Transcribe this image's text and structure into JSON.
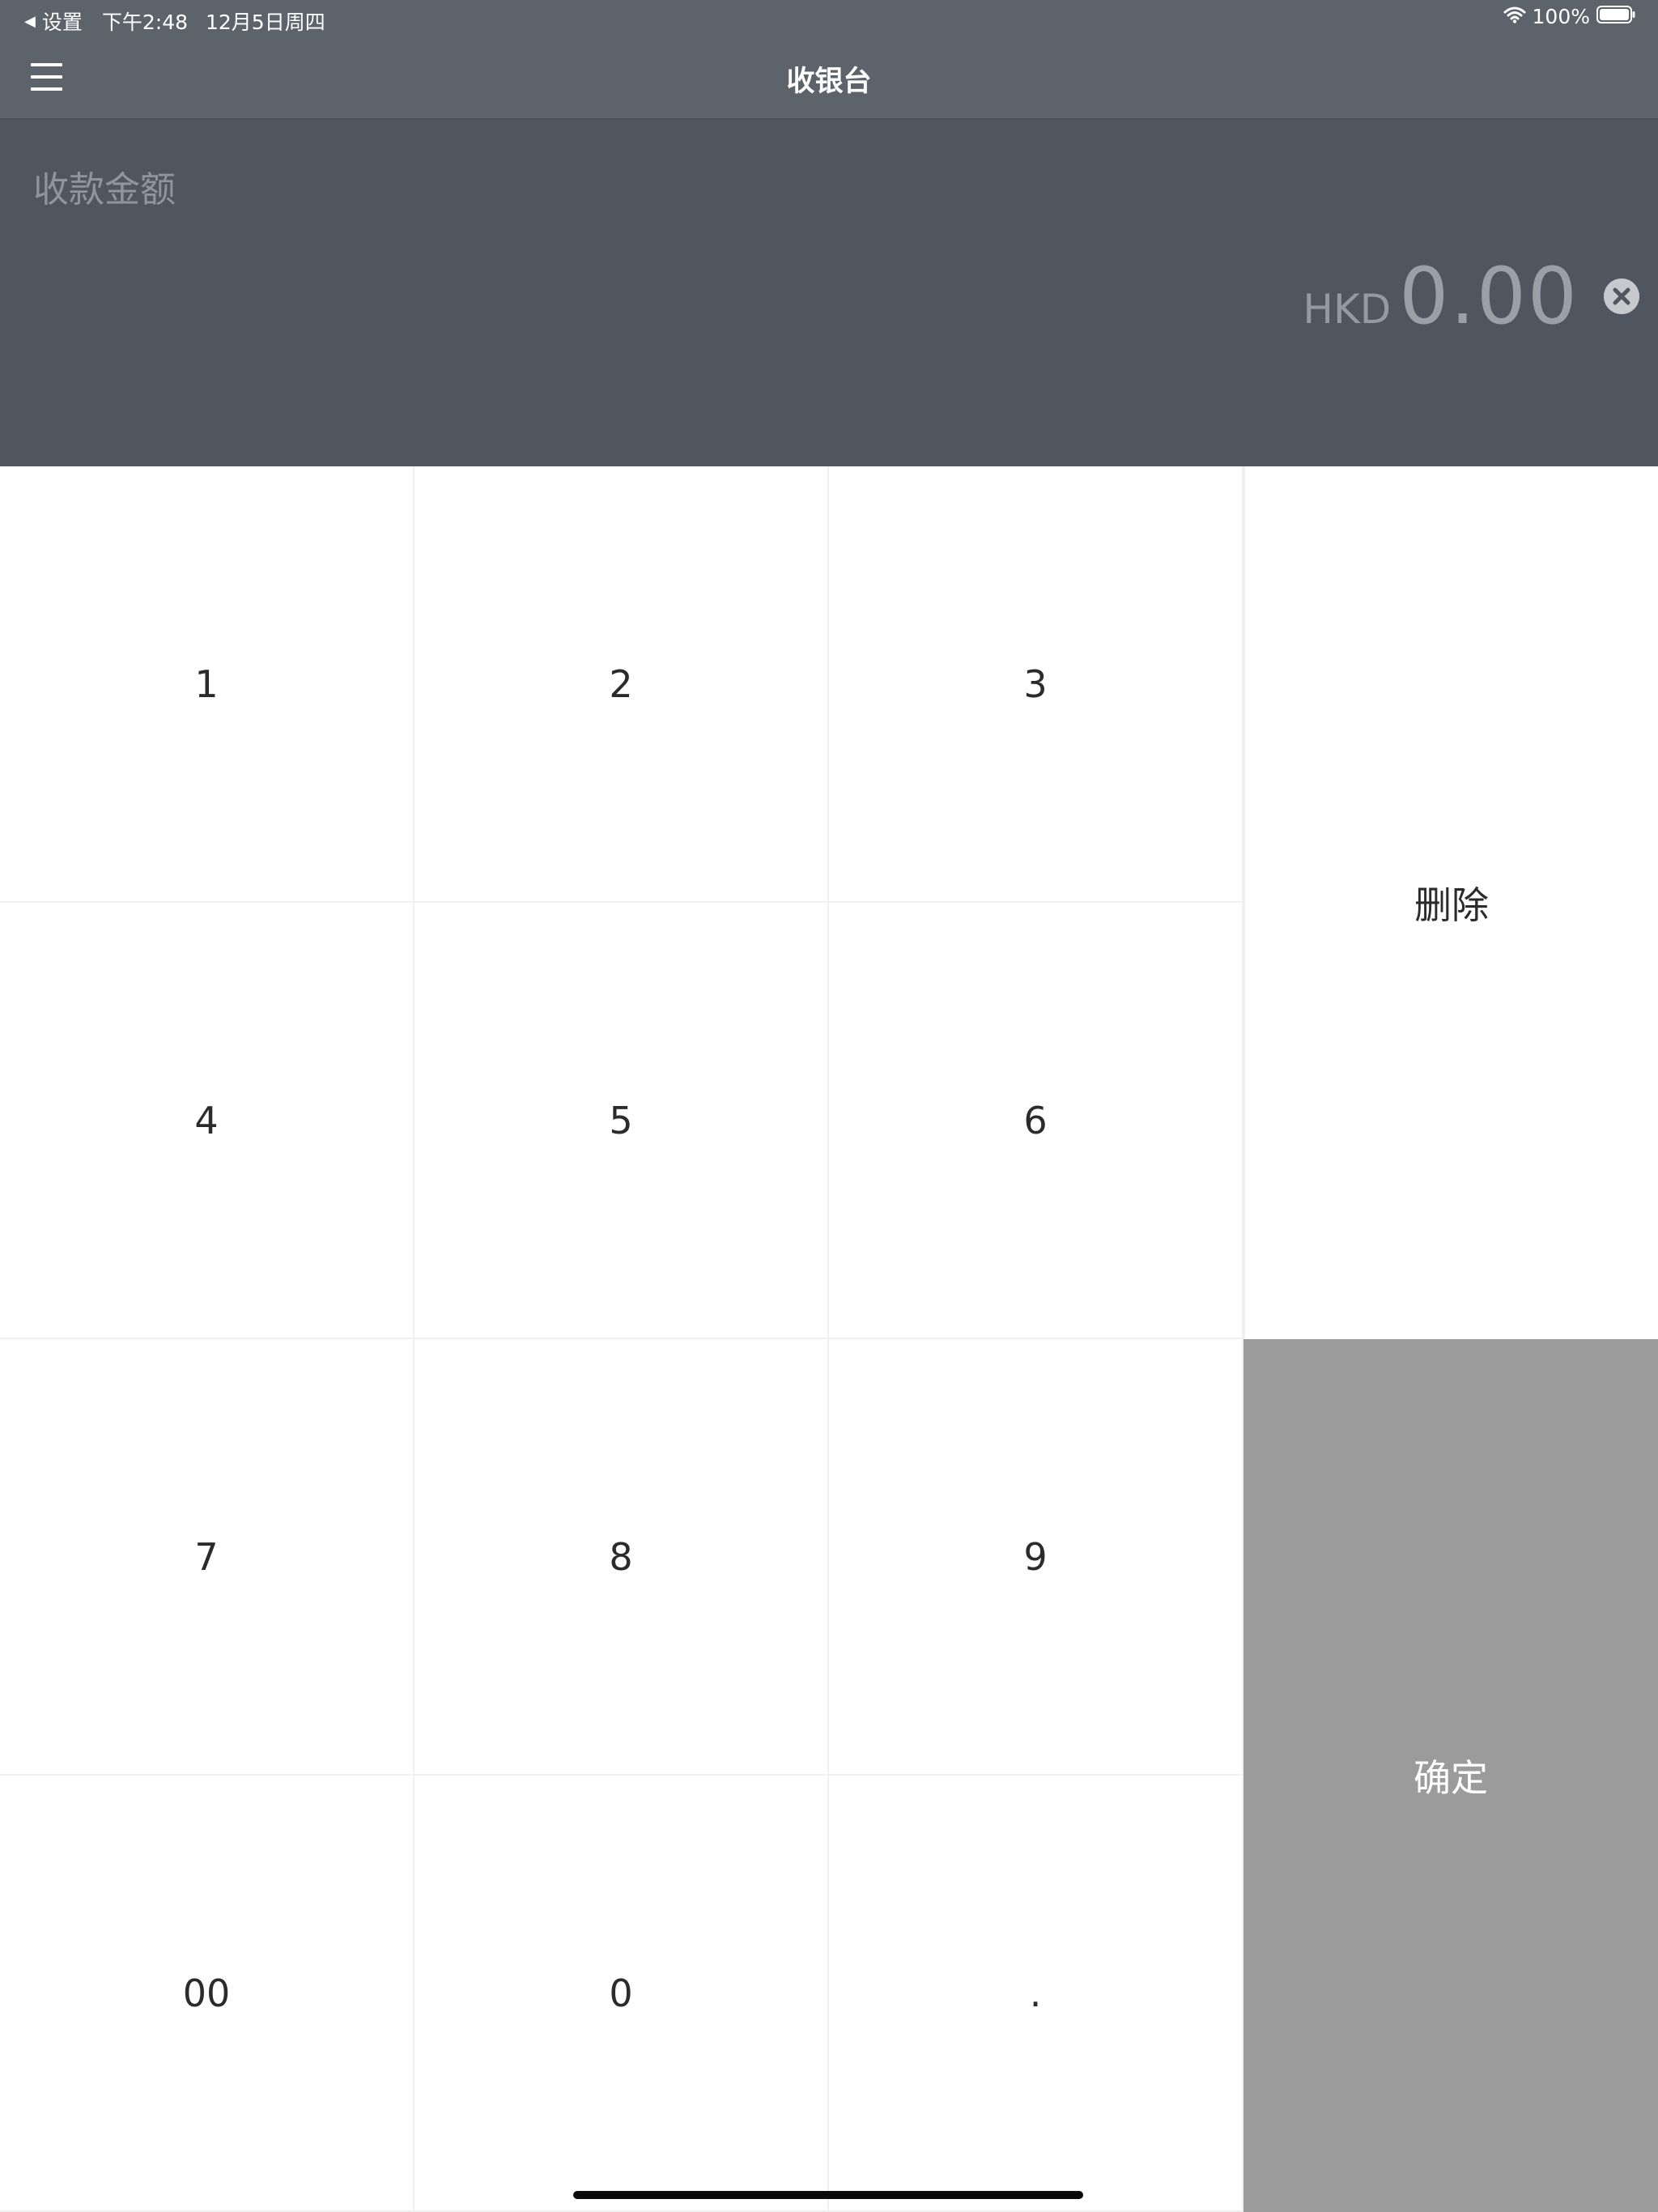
{
  "status_bar": {
    "back_label": "设置",
    "time": "下午2:48",
    "date": "12月5日周四",
    "battery": "100%",
    "icons": [
      "back-arrow-icon",
      "wifi-icon",
      "battery-icon"
    ]
  },
  "nav": {
    "title": "收银台",
    "menu_icon": "hamburger-menu-icon"
  },
  "amount": {
    "label": "收款金额",
    "currency": "HKD",
    "value": "0.00",
    "clear_icon": "clear-circle-icon"
  },
  "keypad": {
    "keys": [
      "1",
      "2",
      "3",
      "4",
      "5",
      "6",
      "7",
      "8",
      "9",
      "00",
      "0",
      "."
    ],
    "delete_label": "删除",
    "confirm_label": "确定"
  },
  "colors": {
    "header_bg": "#5c636b",
    "amount_panel_bg": "#4f5660",
    "confirm_bg": "#9b9b9b",
    "key_text": "#2b2b2b"
  }
}
